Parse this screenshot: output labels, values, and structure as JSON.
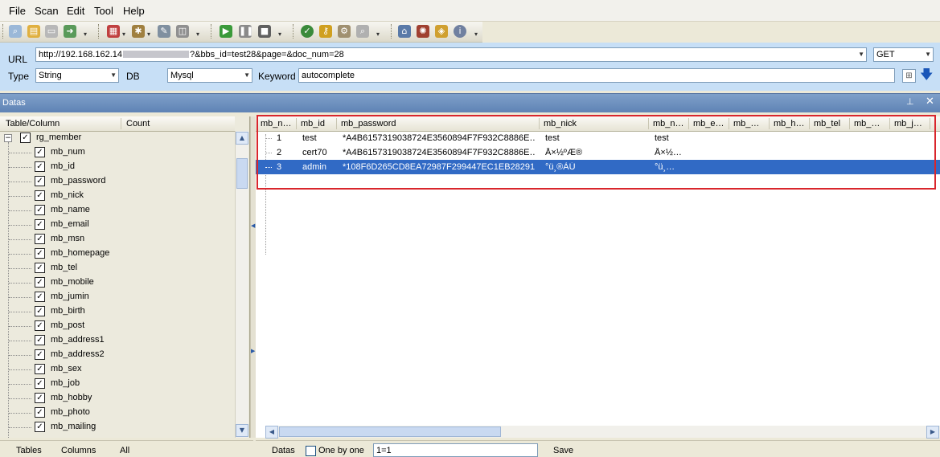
{
  "menu": [
    "File",
    "Scan",
    "Edit",
    "Tool",
    "Help"
  ],
  "config": {
    "url_label": "URL",
    "url_value_prefix": "http://192.168.162.14",
    "url_value_suffix": "?&bbs_id=test28&page=&doc_num=28",
    "method_value": "GET",
    "type_label": "Type",
    "type_value": "String",
    "db_label": "DB",
    "db_value": "Mysql",
    "keyword_label": "Keyword",
    "keyword_value": "autocomplete"
  },
  "datas_panel": {
    "title": "Datas",
    "pin_icon": "pin-icon",
    "close_icon": "close-icon"
  },
  "tree": {
    "col_table": "Table/Column",
    "col_count": "Count",
    "table": "rg_member",
    "columns": [
      "mb_num",
      "mb_id",
      "mb_password",
      "mb_nick",
      "mb_name",
      "mb_email",
      "mb_msn",
      "mb_homepage",
      "mb_tel",
      "mb_mobile",
      "mb_jumin",
      "mb_birth",
      "mb_post",
      "mb_address1",
      "mb_address2",
      "mb_sex",
      "mb_job",
      "mb_hobby",
      "mb_photo",
      "mb_mailing"
    ]
  },
  "grid": {
    "headers": [
      "mb_n…",
      "mb_id",
      "mb_password",
      "mb_nick",
      "mb_n…",
      "mb_e…",
      "mb_…",
      "mb_h…",
      "mb_tel",
      "mb_…",
      "mb_j…"
    ],
    "rows": [
      {
        "num": "1",
        "id": "test",
        "password": "*A4B6157319038724E3560894F7F932C8886E…",
        "nick": "test",
        "name": "test"
      },
      {
        "num": "2",
        "id": "cert70",
        "password": "*A4B6157319038724E3560894F7F932C8886E…",
        "nick": "Å×½ºÆ®",
        "name": "Å×½…"
      },
      {
        "num": "3",
        "id": "admin",
        "password": "*108F6D265CD8EA72987F299447EC1EB28291…",
        "nick": "°ü¸®ÀÚ",
        "name": "°ü¸…"
      }
    ],
    "selected_row": 3
  },
  "bottom_left": {
    "tabs": [
      "Tables",
      "Columns",
      "All"
    ]
  },
  "bottom_right": {
    "datas_label": "Datas",
    "one_by_one_label": "One by one",
    "condition_value": "1=1",
    "save_label": "Save"
  },
  "colors": {
    "selection": "#316ac5",
    "highlight_box": "#d9262c",
    "config_bg": "#c7dff6"
  }
}
